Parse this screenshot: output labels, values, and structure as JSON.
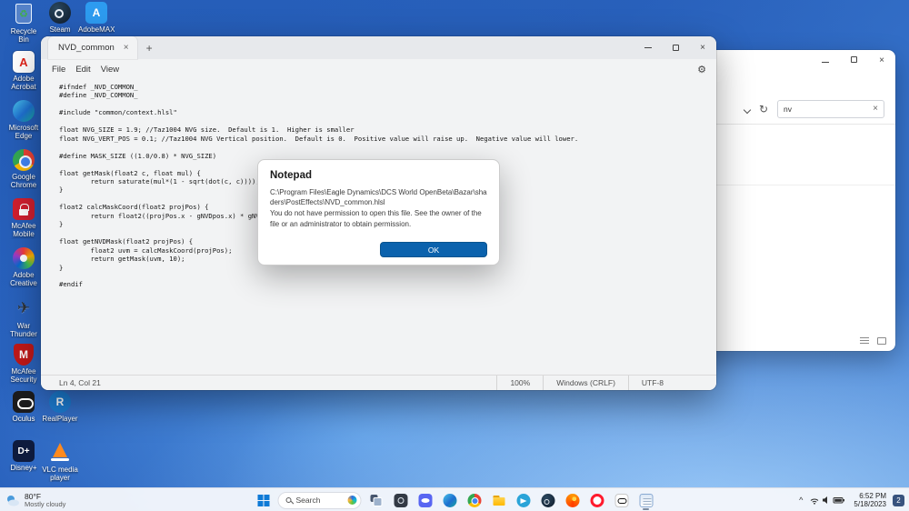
{
  "desktop": {
    "icons": [
      {
        "label": "Recycle Bin",
        "icon": "recycle-bin-icon"
      },
      {
        "label": "Steam",
        "icon": "steam-icon"
      },
      {
        "label": "AdobeMAX",
        "icon": "adobemax-icon"
      },
      {
        "label": "Adobe Acrobat",
        "icon": "acrobat-icon"
      },
      {
        "label": "Microsoft Edge",
        "icon": "edge-icon"
      },
      {
        "label": "Google Chrome",
        "icon": "chrome-icon"
      },
      {
        "label": "McAfee Mobile Connect",
        "icon": "mcafee-lock-icon"
      },
      {
        "label": "Adobe Creative Cloud",
        "icon": "creative-cloud-icon"
      },
      {
        "label": "War Thunder",
        "icon": "eagle-icon"
      },
      {
        "label": "McAfee Security Scan",
        "icon": "mcafee-shield-icon"
      },
      {
        "label": "Oculus",
        "icon": "oculus-icon"
      },
      {
        "label": "RealPlayer",
        "icon": "realplayer-icon"
      },
      {
        "label": "Disney+",
        "icon": "disney-plus-icon"
      },
      {
        "label": "VLC media player",
        "icon": "vlc-cone-icon"
      }
    ]
  },
  "explorer_window": {
    "search_value": "nv",
    "icons": [
      "minimize-icon",
      "maximize-icon",
      "close-icon",
      "chevron-down-icon",
      "refresh-icon",
      "clear-search-icon",
      "list-view-icon",
      "thumbnail-view-icon"
    ]
  },
  "notepad": {
    "tab_title": "NVD_common",
    "menus": [
      "File",
      "Edit",
      "View"
    ],
    "code_lines": [
      "#ifndef _NVD_COMMON_",
      "#define _NVD_COMMON_",
      "",
      "#include \"common/context.hlsl\"",
      "",
      "float NVG_SIZE = 1.9; //Taz1004 NVG size.  Default is 1.  Higher is smaller",
      "float NVG_VERT_POS = 0.1; //Taz1004 NVG Vertical position.  Default is 0.  Positive value will raise up.  Negative value will lower.",
      "",
      "#define MASK_SIZE ((1.0/0.8) * NVG_SIZE)",
      "",
      "float getMask(float2 c, float mul) {",
      "        return saturate(mul*(1 - sqrt(dot(c, c))));",
      "}",
      "",
      "float2 calcMaskCoord(float2 projPos) {",
      "        return float2((projPos.x - gNVDpos.x) * gNVDaspect",
      "}",
      "",
      "float getNVDMask(float2 projPos) {",
      "        float2 uvm = calcMaskCoord(projPos);",
      "        return getMask(uvm, 10);",
      "}",
      "",
      "#endif"
    ],
    "status_bar": {
      "position": "Ln 4, Col 21",
      "zoom": "100%",
      "line_ending": "Windows (CRLF)",
      "encoding": "UTF-8"
    }
  },
  "dialog": {
    "title": "Notepad",
    "path": "C:\\Program Files\\Eagle Dynamics\\DCS World OpenBeta\\Bazar\\shaders\\PostEffects\\NVD_common.hlsl",
    "message": "You do not have permission to open this file.  See the owner of the file or an administrator to obtain permission.",
    "ok_label": "OK"
  },
  "taskbar": {
    "weather": {
      "temperature": "80°F",
      "condition": "Mostly cloudy"
    },
    "search_label": "Search",
    "app_icons": [
      "task-view",
      "photos",
      "discord",
      "edge",
      "chrome",
      "file-explorer",
      "telegram",
      "steam",
      "firefox",
      "opera",
      "oculus",
      "notepad"
    ],
    "active_app": "notepad"
  },
  "system_tray": {
    "time": "6:52 PM",
    "date": "5/18/2023",
    "notification_count": "2",
    "icons": [
      "chevron-up-icon",
      "wifi-icon",
      "volume-icon",
      "battery-icon"
    ]
  }
}
